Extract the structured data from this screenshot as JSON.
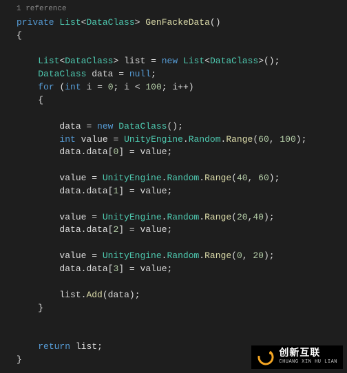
{
  "codelens": "1 reference",
  "code": {
    "modifier": "private",
    "return_type_generic": "List",
    "return_type_param": "DataClass",
    "method_name": "GenFackeData",
    "decl_list_type": "List",
    "decl_list_param": "DataClass",
    "var_list": "list",
    "kw_new": "new",
    "var_data": "data",
    "type_dataclass": "DataClass",
    "kw_null": "null",
    "kw_for": "for",
    "kw_int": "int",
    "var_i": "i",
    "lit_0": "0",
    "lit_100": "100",
    "lit_60": "60",
    "lit_40": "40",
    "lit_20": "20",
    "lit_1": "1",
    "lit_2": "2",
    "lit_3": "3",
    "var_value": "value",
    "ns_unity": "UnityEngine",
    "cls_random": "Random",
    "m_range": "Range",
    "prop_data": "data",
    "m_add": "Add",
    "kw_return": "return",
    "opp": "(",
    "cpp": ")",
    "ob": "{",
    "cb": "}",
    "obx": "[",
    "cbx": "]",
    "semi": ";",
    "comma": ", ",
    "comma_tight": ",",
    "eq": " = ",
    "lt": " < ",
    "ipp": "i++",
    "empty_parens": "()",
    "angle_o": "<",
    "angle_c": ">",
    "dot": "."
  },
  "watermark": {
    "cn": "创新互联",
    "en": "CHUANG XIN HU LIAN"
  }
}
